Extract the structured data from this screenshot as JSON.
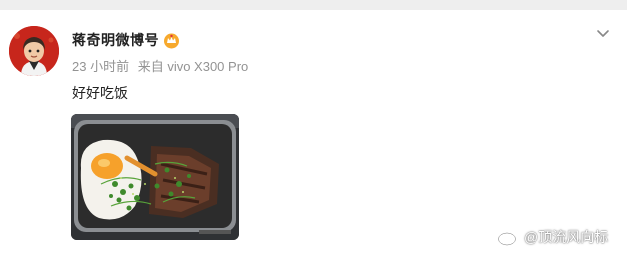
{
  "post": {
    "author": "蒋奇明微博号",
    "time": "23 小时前",
    "source": "来自 vivo X300 Pro",
    "text": "好好吃饭"
  },
  "icons": {
    "avatar": "avatar-cartoon",
    "badge": "vip-crown-icon",
    "more": "chevron-down-icon",
    "watermark_logo": "weibo-logo-icon"
  },
  "watermark": {
    "text": "@顶流风向标"
  },
  "colors": {
    "meta": "#939393",
    "badge": "#f7a92d",
    "avatar_bg": "#c7261c"
  }
}
